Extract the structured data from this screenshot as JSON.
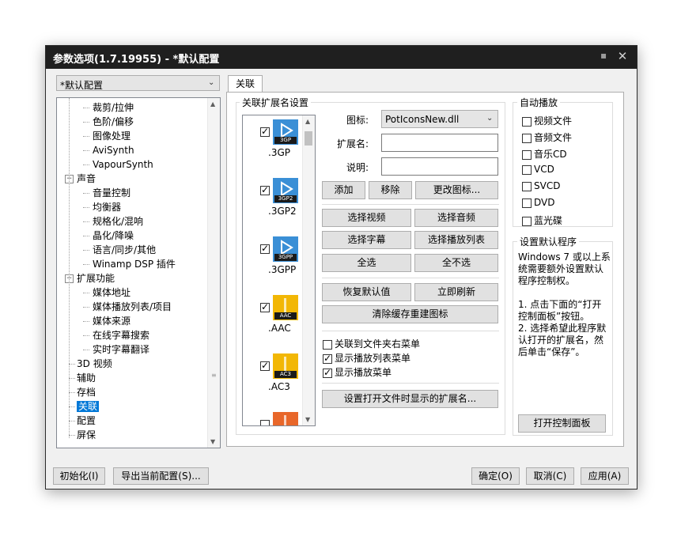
{
  "window": {
    "title": "参数选项(1.7.19955) - *默认配置",
    "pin_glyph": "▪",
    "close_glyph": "✕"
  },
  "profile": {
    "selected": "*默认配置"
  },
  "tree": {
    "items": [
      {
        "label": "裁剪/拉伸",
        "level": 2
      },
      {
        "label": "色阶/偏移",
        "level": 2
      },
      {
        "label": "图像处理",
        "level": 2
      },
      {
        "label": "AviSynth",
        "level": 2
      },
      {
        "label": "VapourSynth",
        "level": 2
      },
      {
        "label": "声音",
        "level": 1,
        "expander": "−"
      },
      {
        "label": "音量控制",
        "level": 2
      },
      {
        "label": "均衡器",
        "level": 2
      },
      {
        "label": "规格化/混响",
        "level": 2
      },
      {
        "label": "晶化/降噪",
        "level": 2
      },
      {
        "label": "语言/同步/其他",
        "level": 2
      },
      {
        "label": "Winamp DSP 插件",
        "level": 2
      },
      {
        "label": "扩展功能",
        "level": 1,
        "expander": "−"
      },
      {
        "label": "媒体地址",
        "level": 2
      },
      {
        "label": "媒体播放列表/项目",
        "level": 2
      },
      {
        "label": "媒体来源",
        "level": 2
      },
      {
        "label": "在线字幕搜索",
        "level": 2
      },
      {
        "label": "实时字幕翻译",
        "level": 2
      },
      {
        "label": "3D 视频",
        "level": 1
      },
      {
        "label": "辅助",
        "level": 1
      },
      {
        "label": "存档",
        "level": 1
      },
      {
        "label": "关联",
        "level": 1,
        "selected": true
      },
      {
        "label": "配置",
        "level": 1
      },
      {
        "label": "屏保",
        "level": 1
      }
    ]
  },
  "tab": {
    "label": "关联"
  },
  "assoc": {
    "group_title": "关联扩展名设置",
    "files": [
      {
        "ext": ".3GP",
        "badge": "3GP",
        "color": "#3a8fd6",
        "checked": true
      },
      {
        "ext": ".3GP2",
        "badge": "3GP2",
        "color": "#3a8fd6",
        "checked": true
      },
      {
        "ext": ".3GPP",
        "badge": "3GPP",
        "color": "#3a8fd6",
        "checked": true
      },
      {
        "ext": ".AAC",
        "badge": "AAC",
        "color": "#f2b705",
        "checked": true
      },
      {
        "ext": ".AC3",
        "badge": "AC3",
        "color": "#f2b705",
        "checked": true
      },
      {
        "ext": "",
        "badge": "",
        "color": "#e8672a",
        "checked": false
      }
    ],
    "icon_label": "图标:",
    "icon_value": "PotIconsNew.dll",
    "ext_label": "扩展名:",
    "ext_value": "",
    "desc_label": "说明:",
    "desc_value": "",
    "btn_add": "添加",
    "btn_remove": "移除",
    "btn_change_icon": "更改图标...",
    "btn_select_video": "选择视频",
    "btn_select_audio": "选择音频",
    "btn_select_sub": "选择字幕",
    "btn_select_playlist": "选择播放列表",
    "btn_select_all": "全选",
    "btn_select_none": "全不选",
    "btn_restore": "恢复默认值",
    "btn_refresh": "立即刷新",
    "btn_clear_cache": "清除缓存重建图标",
    "opt_folder_menu": {
      "label": "关联到文件夹右菜单",
      "checked": false
    },
    "opt_playlist_menu": {
      "label": "显示播放列表菜单",
      "checked": true
    },
    "opt_play_menu": {
      "label": "显示播放菜单",
      "checked": true
    },
    "btn_open_ext": "设置打开文件时显示的扩展名..."
  },
  "autoplay": {
    "title": "自动播放",
    "items": [
      {
        "label": "视频文件",
        "checked": false
      },
      {
        "label": "音频文件",
        "checked": false
      },
      {
        "label": "音乐CD",
        "checked": false
      },
      {
        "label": "VCD",
        "checked": false
      },
      {
        "label": "SVCD",
        "checked": false
      },
      {
        "label": "DVD",
        "checked": false
      },
      {
        "label": "蓝光碟",
        "checked": false
      }
    ]
  },
  "default_prog": {
    "title": "设置默认程序",
    "text_lines": [
      "Windows 7 或以上系",
      "统需要额外设置默认",
      "程序控制权。",
      "",
      "1. 点击下面的“打开",
      "控制面板”按钮。",
      "2. 选择希望此程序默",
      "认打开的扩展名，然",
      "后单击“保存”。"
    ],
    "btn": "打开控制面板"
  },
  "footer": {
    "init": "初始化(I)",
    "export": "导出当前配置(S)...",
    "ok": "确定(O)",
    "cancel": "取消(C)",
    "apply": "应用(A)"
  }
}
